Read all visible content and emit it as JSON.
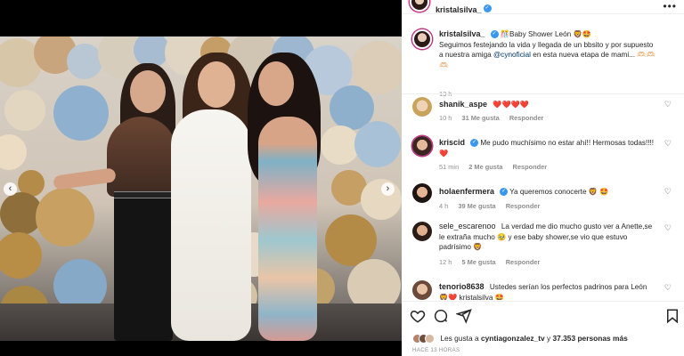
{
  "post": {
    "author": "kristalsilva_",
    "caption_author": "kristalsilva_",
    "caption_line1": "🎊Baby Shower León 🦁🤩",
    "caption_body_pre": "Seguimos festejando la vida y llegada de un bbsito y por supuesto a nuestra amiga ",
    "caption_mention": "@cynoficial",
    "caption_body_post": " en esta nueva etapa de mami... 🫶🏻🫶🏻🫶🏻",
    "caption_time": "13 h"
  },
  "comments": [
    {
      "user": "shanik_aspe",
      "text": "❤️❤️❤️❤️",
      "time": "10 h",
      "likes": "31 Me gusta",
      "reply": "Responder"
    },
    {
      "user": "kriscid",
      "verified": true,
      "text": "Me pudo muchísimo no estar ahí!! Hermosas todas!!!! ❤️",
      "time": "51 min",
      "likes": "2 Me gusta",
      "reply": "Responder"
    },
    {
      "user": "holaenfermera",
      "verified": true,
      "text": "Ya queremos conocerte 🦁 🤩",
      "time": "4 h",
      "likes": "39 Me gusta",
      "reply": "Responder"
    },
    {
      "user": "sele_escarenoo",
      "text": "La verdad me dio mucho gusto ver a Anette,se le extraña mucho 🥹 y ese baby shower,se vio que estuvo padrísimo 🦁",
      "time": "12 h",
      "likes": "5 Me gusta",
      "reply": "Responder"
    },
    {
      "user": "tenorio8638",
      "text": "Ustedes serían los perfectos padrinos para León 🦁❤️ kristalsilva 🤩"
    }
  ],
  "likes_line": {
    "prefix": "Les gusta a ",
    "user": "cyntiagonzalez_tv",
    "middle": " y ",
    "count": "37.353 personas más"
  },
  "time_ago": "HACE 13 HORAS",
  "icons": {
    "more": "more-horizontal-icon",
    "heart": "heart-icon",
    "comment": "comment-icon",
    "share": "share-icon",
    "save": "bookmark-icon",
    "prev": "chevron-left-icon",
    "next": "chevron-right-icon"
  },
  "colors": {
    "verified": "#3897f0",
    "mention": "#00376b",
    "meta": "#8e8e8e"
  }
}
